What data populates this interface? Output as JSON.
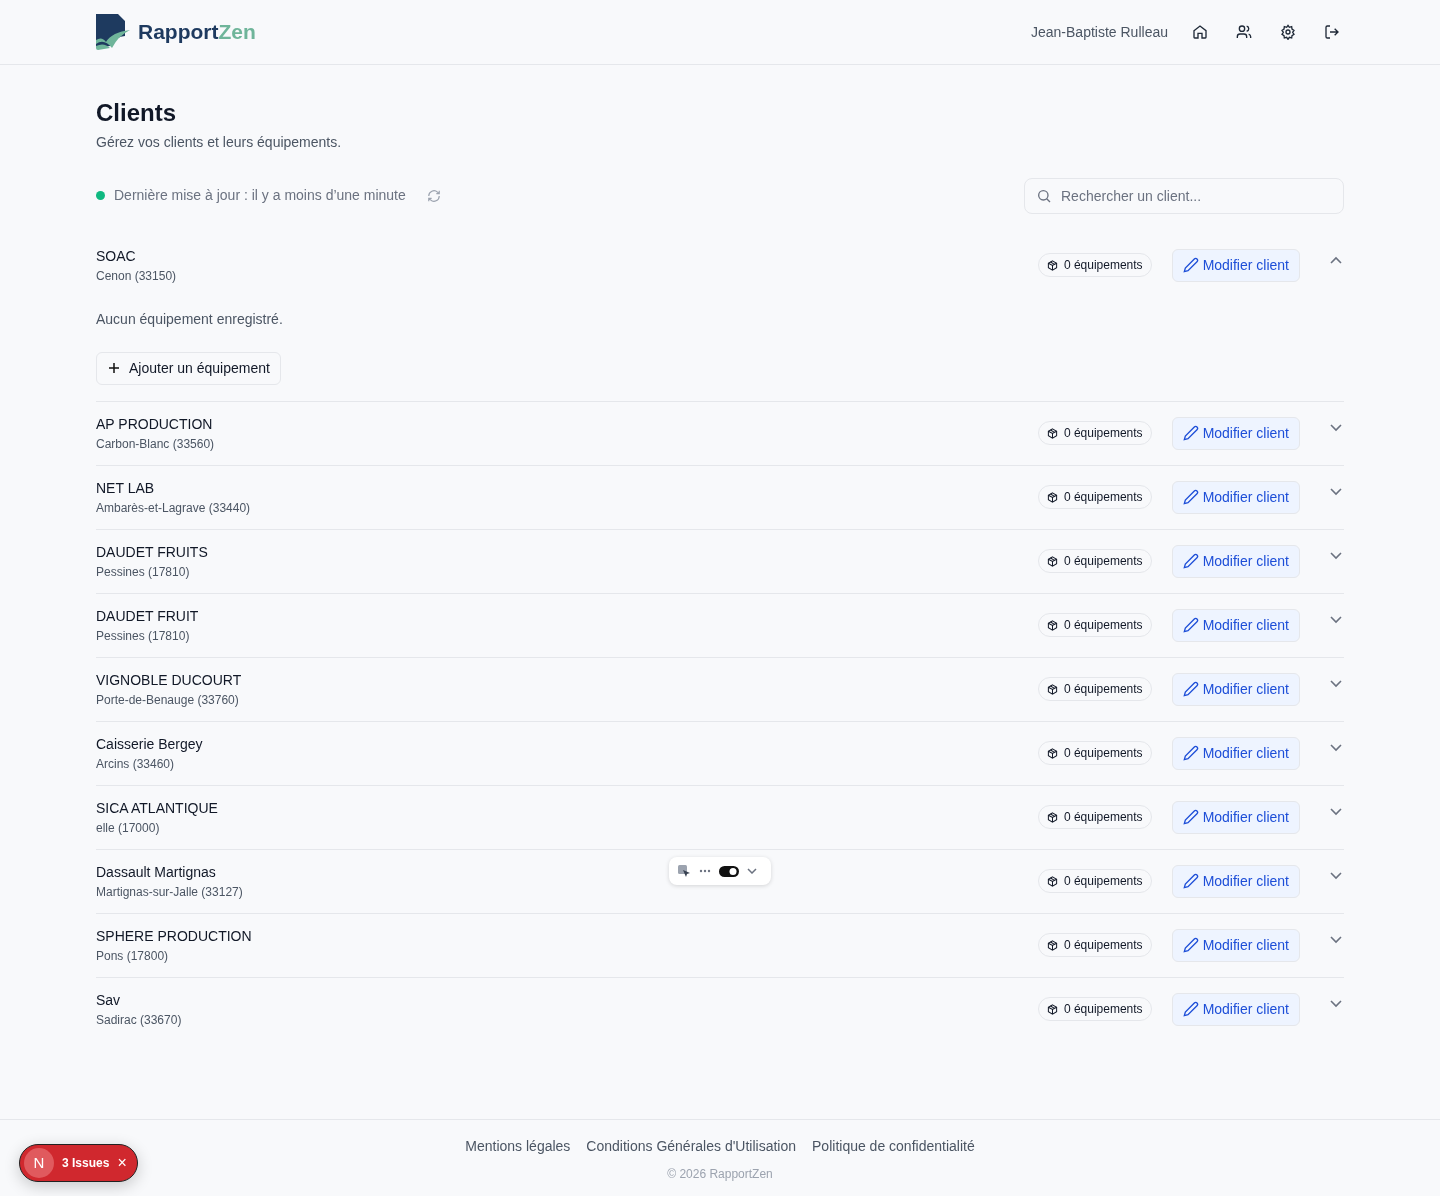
{
  "brand": {
    "name_a": "Rapport",
    "name_b": "Zen"
  },
  "header": {
    "user": "Jean-Baptiste Rulleau"
  },
  "page": {
    "title": "Clients",
    "subtitle": "Gérez vos clients et leurs équipements."
  },
  "status": {
    "text": "Dernière mise à jour : il y a moins d’une minute",
    "color": "#10b981"
  },
  "search": {
    "placeholder": "Rechercher un client..."
  },
  "clients": [
    {
      "name": "SOAC",
      "location": "Cenon (33150)",
      "equipment_count": "0 équipements",
      "edit": "Modifier client",
      "expanded": true,
      "empty_text": "Aucun équipement enregistré.",
      "add_button": "Ajouter un équipement"
    },
    {
      "name": "AP PRODUCTION",
      "location": "Carbon-Blanc (33560)",
      "equipment_count": "0 équipements",
      "edit": "Modifier client",
      "expanded": false
    },
    {
      "name": "NET LAB",
      "location": "Ambarès-et-Lagrave (33440)",
      "equipment_count": "0 équipements",
      "edit": "Modifier client",
      "expanded": false
    },
    {
      "name": "DAUDET FRUITS",
      "location": "Pessines (17810)",
      "equipment_count": "0 équipements",
      "edit": "Modifier client",
      "expanded": false
    },
    {
      "name": "DAUDET FRUIT",
      "location": "Pessines (17810)",
      "equipment_count": "0 équipements",
      "edit": "Modifier client",
      "expanded": false
    },
    {
      "name": "VIGNOBLE DUCOURT",
      "location": "Porte-de-Benauge (33760)",
      "equipment_count": "0 équipements",
      "edit": "Modifier client",
      "expanded": false
    },
    {
      "name": "Caisserie Bergey",
      "location": "Arcins (33460)",
      "equipment_count": "0 équipements",
      "edit": "Modifier client",
      "expanded": false
    },
    {
      "name": "SICA ATLANTIQUE",
      "location": "elle (17000)",
      "equipment_count": "0 équipements",
      "edit": "Modifier client",
      "expanded": false
    },
    {
      "name": "Dassault Martignas",
      "location": "Martignas-sur-Jalle (33127)",
      "equipment_count": "0 équipements",
      "edit": "Modifier client",
      "expanded": false
    },
    {
      "name": "SPHERE PRODUCTION",
      "location": "Pons (17800)",
      "equipment_count": "0 équipements",
      "edit": "Modifier client",
      "expanded": false
    },
    {
      "name": "Sav",
      "location": "Sadirac (33670)",
      "equipment_count": "0 équipements",
      "edit": "Modifier client",
      "expanded": false
    }
  ],
  "footer": {
    "links": [
      "Mentions légales",
      "Conditions Générales d'Utilisation",
      "Politique de confidentialité"
    ],
    "copyright": "© 2026 RapportZen"
  },
  "dev_toolbar": {
    "toggle_on": true
  },
  "dev_badge": {
    "letter": "N",
    "text": "3 Issues",
    "close": "×"
  }
}
